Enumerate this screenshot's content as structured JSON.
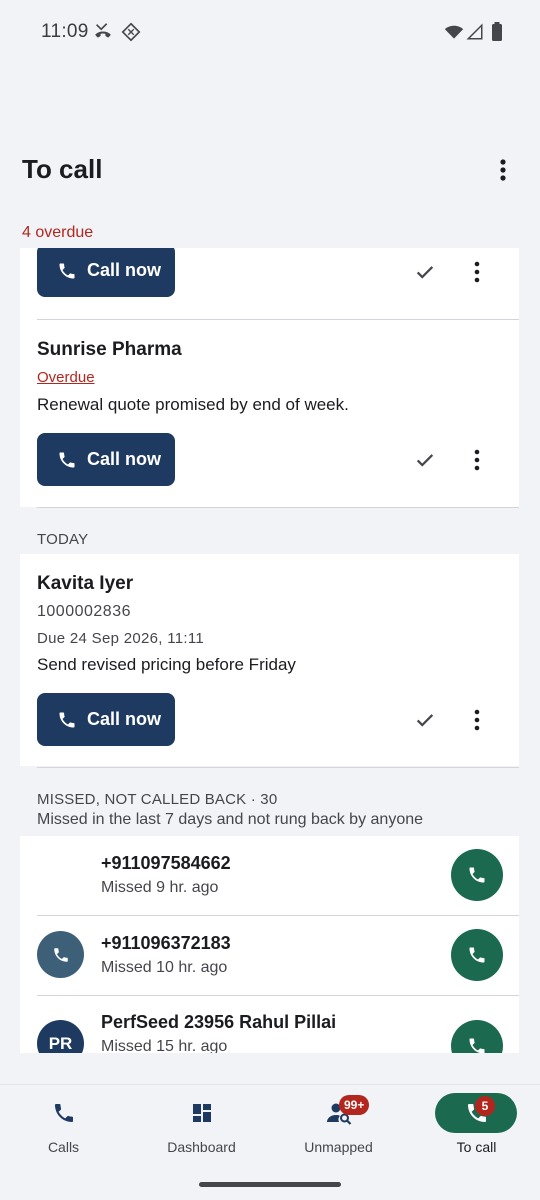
{
  "status_bar": {
    "time": "11:09",
    "icons": [
      "missed-call-icon",
      "vpn-diamond-icon",
      "wifi-icon",
      "signal-icon",
      "battery-icon"
    ]
  },
  "app_bar": {
    "title": "To call",
    "overdue_summary": "4 overdue",
    "menu_icon": "more-vertical-icon"
  },
  "overdue": {
    "items": [
      {
        "call_label": "Call now"
      },
      {
        "name": "Sunrise Pharma",
        "status": "Overdue",
        "note": "Renewal quote promised by end of week.",
        "call_label": "Call now"
      }
    ]
  },
  "today": {
    "header": "TODAY",
    "items": [
      {
        "name": "Kavita Iyer",
        "phone": "1000002836",
        "due": "Due 24 Sep 2026, 11:11",
        "note": "Send revised pricing before Friday",
        "call_label": "Call now"
      }
    ]
  },
  "missed": {
    "header": "MISSED, NOT CALLED BACK · 30",
    "subtitle": "Missed in the last 7 days and not rung back by anyone",
    "items": [
      {
        "number": "+911097584662",
        "time": "Missed 9 hr. ago",
        "avatar_color": "#1b6a4f",
        "avatar_text": ""
      },
      {
        "number": "+911096372183",
        "time": "Missed 10 hr. ago",
        "avatar_color": "#3e5f78",
        "avatar_text": ""
      },
      {
        "number": "PerfSeed 23956 Rahul Pillai",
        "time": "Missed 15 hr. ago",
        "avatar_color": "#1f3a60",
        "avatar_text": "PR"
      }
    ]
  },
  "bottom_nav": {
    "items": [
      {
        "label": "Calls",
        "icon": "phone-icon"
      },
      {
        "label": "Dashboard",
        "icon": "dashboard-icon"
      },
      {
        "label": "Unmapped",
        "icon": "person-search-icon",
        "badge": "99+"
      },
      {
        "label": "To call",
        "icon": "phone-callback-icon",
        "badge": "5",
        "active": true
      }
    ]
  },
  "colors": {
    "primary_button": "#1f3a60",
    "call_green": "#1b6a4f",
    "error_red": "#b3261e",
    "background": "#f2f3f7"
  }
}
